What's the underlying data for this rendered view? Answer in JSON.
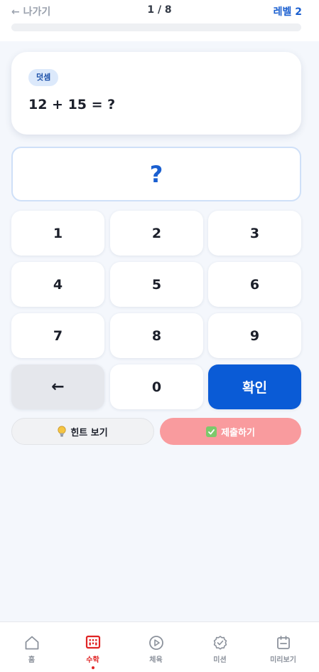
{
  "header": {
    "back_label": "← 나가기",
    "progress_label": "1 / 8",
    "progress_fraction": 0,
    "level_label": "레벨 2"
  },
  "question": {
    "category": "덧셈",
    "text": "12 + 15 = ?"
  },
  "answer": {
    "value": "?"
  },
  "keypad": {
    "keys": [
      "1",
      "2",
      "3",
      "4",
      "5",
      "6",
      "7",
      "8",
      "9"
    ],
    "backspace_label": "←",
    "zero_label": "0",
    "confirm_label": "확인"
  },
  "actions": {
    "hint_label": "힌트 보기",
    "submit_label": "제출하기"
  },
  "nav": {
    "items": [
      {
        "label": "홈",
        "icon": "home-icon"
      },
      {
        "label": "수학",
        "icon": "calculator-icon"
      },
      {
        "label": "체육",
        "icon": "play-icon"
      },
      {
        "label": "미션",
        "icon": "check-badge-icon"
      },
      {
        "label": "미리보기",
        "icon": "calendar-icon"
      }
    ],
    "active_index": 1
  },
  "colors": {
    "accent": "#0a5bd6",
    "active_nav": "#e02424",
    "submit_disabled": "#f99b9e"
  }
}
